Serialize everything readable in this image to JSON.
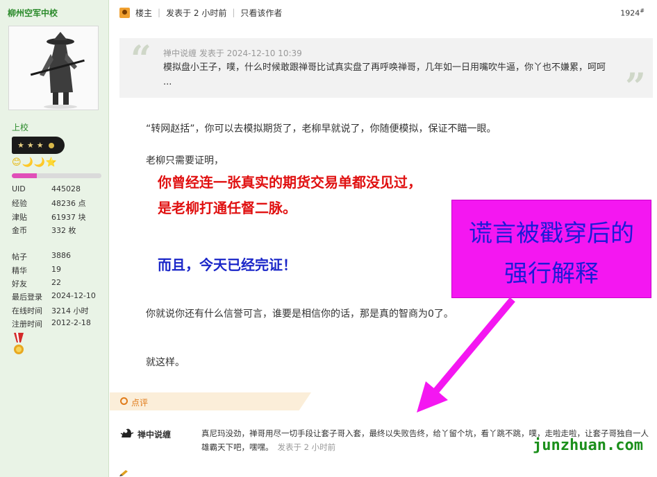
{
  "sidebar": {
    "username": "柳州空军中校",
    "rank": "上校",
    "levels": "😊🌙🌙⭐",
    "exp_progress": 0.28,
    "stats_1": [
      {
        "key": "UID",
        "value": "445028"
      },
      {
        "key": "经验",
        "value": "48236 点"
      },
      {
        "key": "津贴",
        "value": "61937 块"
      },
      {
        "key": "金币",
        "value": "332 枚"
      }
    ],
    "stats_2": [
      {
        "key": "帖子",
        "value": "3886"
      },
      {
        "key": "精华",
        "value": "19"
      },
      {
        "key": "好友",
        "value": "22"
      },
      {
        "key": "最后登录",
        "value": "2024-12-10"
      },
      {
        "key": "在线时间",
        "value": "3214 小时"
      },
      {
        "key": "注册时间",
        "value": "2012-2-18"
      }
    ]
  },
  "post": {
    "author_label": "楼主",
    "time": "发表于 2 小时前",
    "only_author": "只看该作者",
    "floor": "1924",
    "floor_sup": "#"
  },
  "quote": {
    "meta": "禅中说缠 发表于 2024-12-10 10:39",
    "text": "模拟盘小王子，噗，什么时候敢跟禅哥比试真实盘了再呼唤禅哥，几年如一日用嘴吹牛逼，你丫也不嫌累，呵呵 ..."
  },
  "body": {
    "p1": "“转网赵括”，你可以去模拟期货了，老柳早就说了，你随便模拟，保证不瞄一眼。",
    "p2": "老柳只需要证明，",
    "red1": "你曾经连一张真实的期货交易单都没见过，",
    "red2": "是老柳打通任督二脉。",
    "blue": "而且，今天已经完证！",
    "p3": "你就说你还有什么信誉可言，谁要是相信你的话，那是真的智商为0了。",
    "p4": "就这样。"
  },
  "overlay": {
    "line1": "谎言被戳穿后的",
    "line2": "强行解释",
    "color": "#f417f1"
  },
  "comment": {
    "section_label": "点评",
    "user": "禅中说缠",
    "text": "真尼玛没劲，禅哥用尽一切手段让套子哥入套，最终以失败告终，给丫留个坑，看丫跳不跳，噗，走啦走啦，让套子哥独自一人雄霸天下吧，嘿嘿。",
    "time": "发表于 2 小时前"
  },
  "watermark": "junzhuan.com"
}
